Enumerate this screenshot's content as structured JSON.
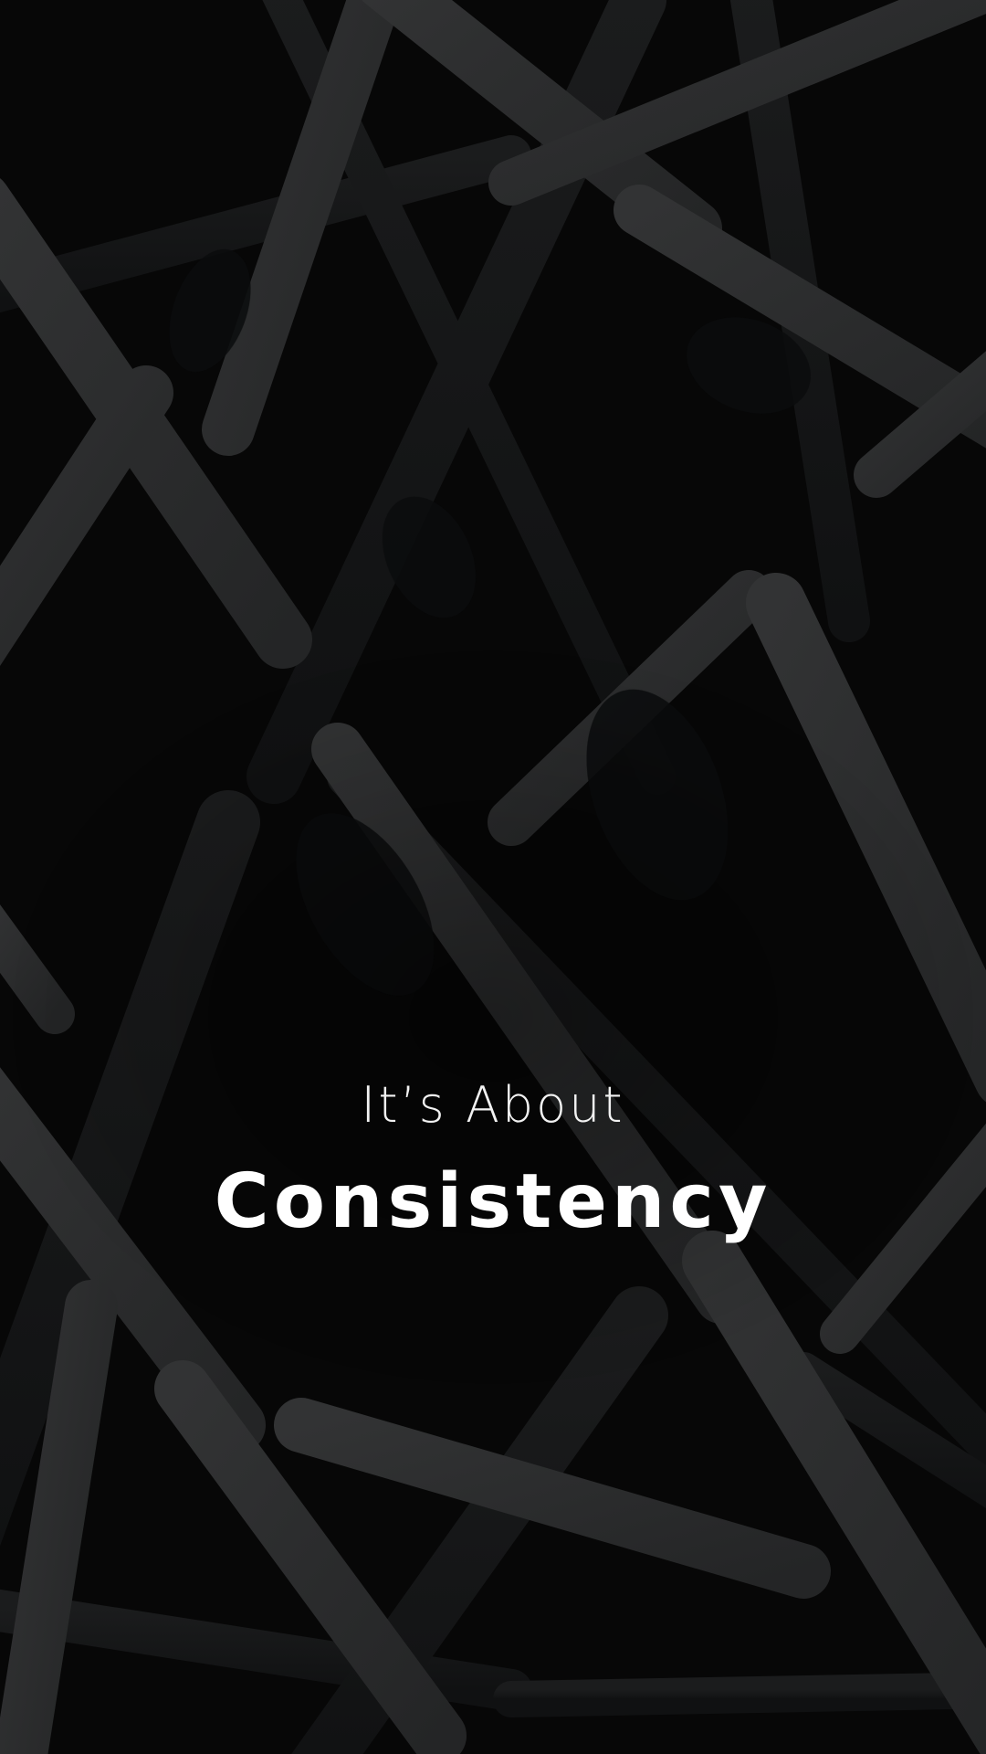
{
  "headline": {
    "line1": "It’s About",
    "line2": "Consistency"
  },
  "colors": {
    "background": "#070707",
    "lattice": "#2b2c2d",
    "lattice_shadow": "#121314",
    "text": "#ffffff"
  }
}
